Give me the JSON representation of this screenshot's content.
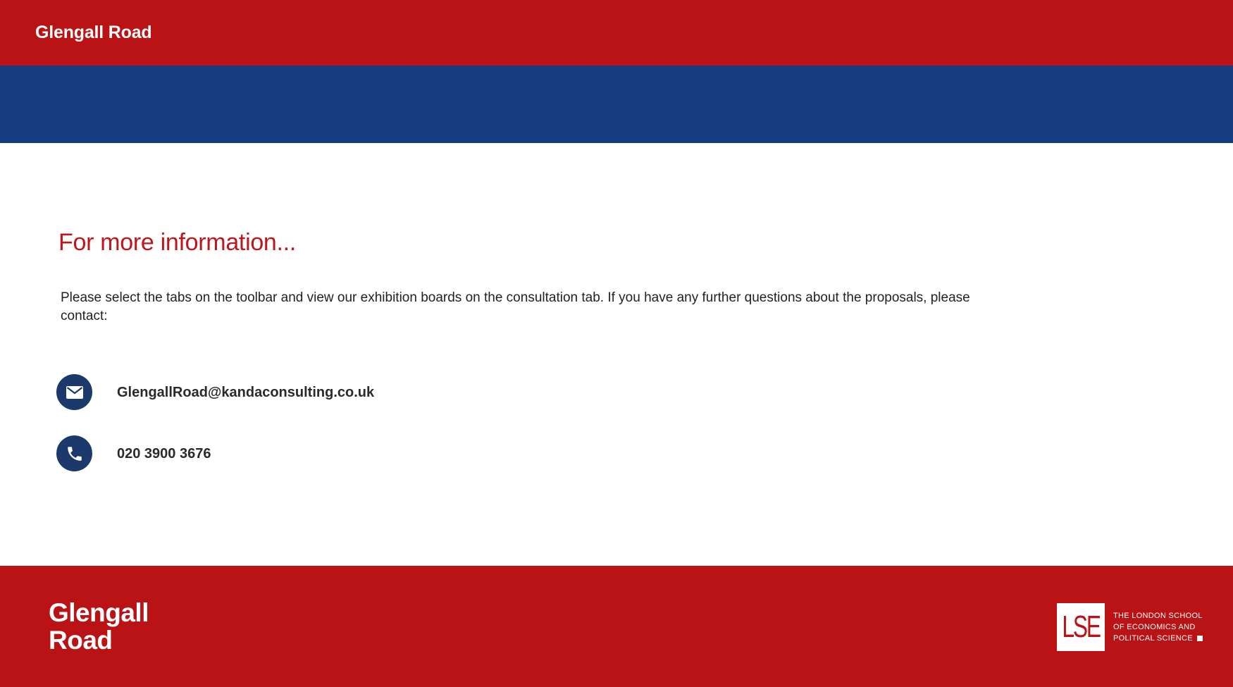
{
  "header": {
    "site_title": "Glengall Road"
  },
  "main": {
    "heading": "For more information...",
    "intro": "Please select the tabs on the toolbar and view our exhibition boards on the consultation tab. If you have any further questions about the proposals, please contact:",
    "contacts": [
      {
        "type": "email",
        "icon": "envelope-icon",
        "value": "GlengallRoad@kandaconsulting.co.uk"
      },
      {
        "type": "phone",
        "icon": "phone-icon",
        "value": "020 3900 3676"
      }
    ]
  },
  "footer": {
    "brand_line1": "Glengall",
    "brand_line2": "Road",
    "partner_logo": {
      "mark": "LSE",
      "line1": "THE LONDON SCHOOL",
      "line2": "OF ECONOMICS AND",
      "line3": "POLITICAL SCIENCE"
    }
  },
  "colors": {
    "brand_red": "#b91315",
    "brand_blue": "#163c80",
    "heading_red": "#c0151b",
    "icon_navy": "#1b3a6b"
  }
}
